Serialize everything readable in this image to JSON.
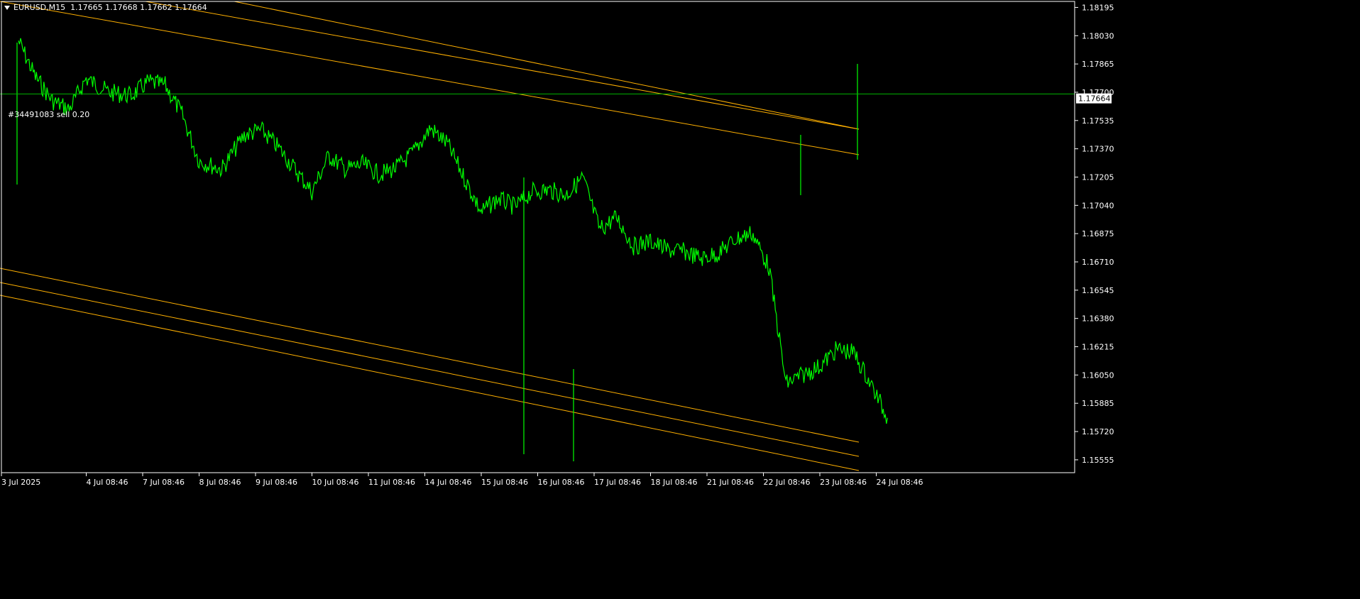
{
  "symbol_bar": {
    "symbol": "EURUSD,M15",
    "ohlc": "1.17665 1.17668 1.17662 1.17664"
  },
  "order_label": "#34491083 sell 0.20",
  "current_price": "1.17664",
  "colors": {
    "background": "#000000",
    "price_line": "#00ff00",
    "channel": "#ffb000",
    "order_line": "#00b400",
    "axis": "#ffffff",
    "price_tag_bg": "#ffffff",
    "price_tag_text": "#000000"
  },
  "chart_data": {
    "type": "line",
    "title": "EURUSD,M15",
    "xlabel": "",
    "ylabel": "",
    "ylim": [
      1.1548,
      1.1823
    ],
    "x_ticks": [
      "3 Jul 2025",
      "4 Jul 08:46",
      "7 Jul 08:46",
      "8 Jul 08:46",
      "9 Jul 08:46",
      "10 Jul 08:46",
      "11 Jul 08:46",
      "14 Jul 08:46",
      "15 Jul 08:46",
      "16 Jul 08:46",
      "17 Jul 08:46",
      "18 Jul 08:46",
      "21 Jul 08:46",
      "22 Jul 08:46",
      "23 Jul 08:46",
      "24 Jul 08:46"
    ],
    "y_ticks": [
      "1.18195",
      "1.18030",
      "1.17865",
      "1.17700",
      "1.17535",
      "1.17370",
      "1.17205",
      "1.17040",
      "1.16875",
      "1.16710",
      "1.16545",
      "1.16380",
      "1.16215",
      "1.16050",
      "1.15885",
      "1.15720",
      "1.15555"
    ],
    "order_price": 1.1769,
    "series": [
      {
        "x": [
          0,
          0.3,
          0.6,
          0.9,
          1.2,
          1.6,
          2,
          2.3,
          2.6,
          2.9,
          3.2,
          3.6,
          4,
          4.3,
          4.6,
          4.9,
          5.2,
          5.5,
          5.8,
          6.1,
          6.4,
          6.7,
          7,
          7.3,
          7.6,
          7.9,
          8.2,
          8.5,
          8.8,
          9.1,
          9.4,
          9.7,
          10,
          10.3,
          10.6,
          10.9,
          11.2,
          11.5,
          11.8,
          12.1,
          12.4,
          12.7,
          13,
          13.3,
          13.6,
          13.9,
          14.2,
          14.5,
          14.8,
          15.1,
          15.4
        ],
        "y": [
          1.18,
          1.1779,
          1.1765,
          1.176,
          1.1778,
          1.177,
          1.1768,
          1.1776,
          1.1774,
          1.1757,
          1.173,
          1.1725,
          1.1745,
          1.1748,
          1.1738,
          1.1725,
          1.1712,
          1.1733,
          1.1725,
          1.1728,
          1.1722,
          1.1726,
          1.1735,
          1.1749,
          1.174,
          1.172,
          1.17,
          1.1708,
          1.1703,
          1.1712,
          1.1713,
          1.171,
          1.172,
          1.169,
          1.1697,
          1.168,
          1.1683,
          1.1678,
          1.1677,
          1.1673,
          1.1676,
          1.1684,
          1.1688,
          1.1668,
          1.16,
          1.1605,
          1.161,
          1.162,
          1.1618,
          1.16,
          1.158
        ]
      }
    ]
  }
}
